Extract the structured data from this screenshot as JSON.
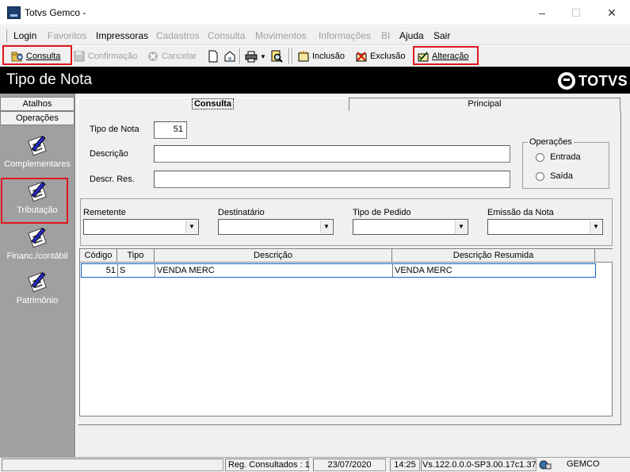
{
  "window": {
    "title": "Totvs Gemco -"
  },
  "menu": {
    "items": [
      {
        "label": "Login",
        "enabled": true
      },
      {
        "label": "Favoritos",
        "enabled": false
      },
      {
        "label": "Impressoras",
        "enabled": true
      },
      {
        "label": "Cadastros",
        "enabled": false
      },
      {
        "label": "Consulta",
        "enabled": false
      },
      {
        "label": "Movimentos",
        "enabled": false
      },
      {
        "label": "Informações",
        "enabled": false
      },
      {
        "label": "BI",
        "enabled": false
      },
      {
        "label": "Ajuda",
        "enabled": true
      },
      {
        "label": "Sair",
        "enabled": true
      }
    ]
  },
  "toolbar": {
    "consulta": "Consulta",
    "confirmacao": "Confirmação",
    "cancelar": "Cancelar",
    "inclusao": "Inclusão",
    "exclusao": "Exclusão",
    "alteracao": "Alteração"
  },
  "header": {
    "title": "Tipo de Nota",
    "brand": "TOTVS"
  },
  "left_panel": {
    "tab_atalhos": "Atalhos",
    "tab_operacoes": "Operações",
    "items": [
      {
        "label": "Complementares"
      },
      {
        "label": "Tributação"
      },
      {
        "label": "Financ./contábil"
      },
      {
        "label": "Patrimônio"
      }
    ]
  },
  "tabs": {
    "consulta": "Consulta",
    "principal": "Principal"
  },
  "form": {
    "tipo_nota_label": "Tipo de Nota",
    "tipo_nota_value": "51",
    "descricao_label": "Descrição",
    "descricao_value": "",
    "descr_res_label": "Descr. Res.",
    "descr_res_value": "",
    "operacoes_label": "Operações",
    "entrada_label": "Entrada",
    "saida_label": "Saída",
    "remetente_label": "Remetente",
    "destinatario_label": "Destinatário",
    "tipo_pedido_label": "Tipo de Pedido",
    "emissao_label": "Emissão da Nota"
  },
  "grid": {
    "columns": [
      "Código",
      "Tipo",
      "Descrição",
      "Descrição Resumida"
    ],
    "rows": [
      [
        "51",
        "S",
        "VENDA MERC",
        "VENDA MERC"
      ]
    ]
  },
  "status": {
    "registros": "Reg. Consultados : 1",
    "date": "23/07/2020",
    "time": "14:25",
    "version": "Vs.122.0.0.0-SP3.00.17c1.37",
    "module": "GEMCO"
  },
  "colors": {
    "highlight": "#e0141e",
    "header_bg": "#000000",
    "selection": "#0a64c8"
  }
}
